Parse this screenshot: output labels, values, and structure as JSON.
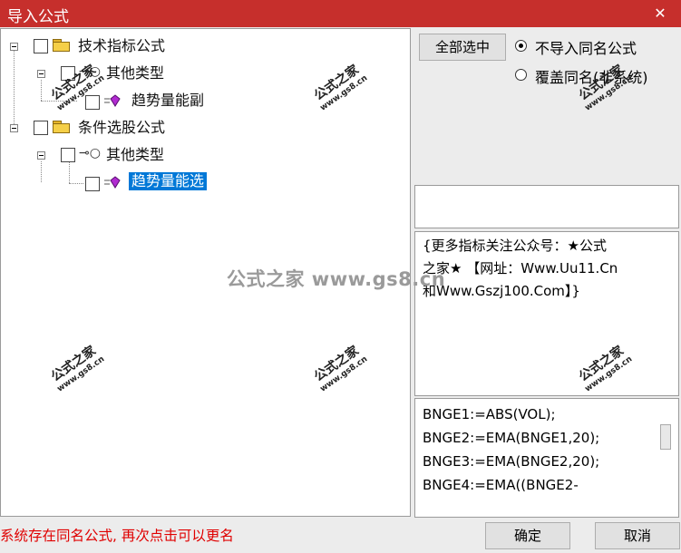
{
  "window": {
    "title": "导入公式",
    "close_glyph": "✕"
  },
  "tree": {
    "nodes": [
      {
        "label": "技术指标公式",
        "icon": "folder-icon"
      },
      {
        "label": "其他类型",
        "icon": "key-icon"
      },
      {
        "label": "趋势量能副",
        "icon": "formula-gem-icon"
      },
      {
        "label": "条件选股公式",
        "icon": "folder-icon"
      },
      {
        "label": "其他类型",
        "icon": "key-icon"
      },
      {
        "label": "趋势量能选",
        "icon": "formula-gem-icon",
        "selected": true
      }
    ]
  },
  "options": {
    "select_all_label": "全部选中",
    "radio1_label": "不导入同名公式",
    "radio2_label": "覆盖同名(非系统)",
    "selected_radio": 1
  },
  "description": {
    "line1": "{更多指标关注公众号：★公式",
    "line2": "之家★ 【网址：Www.Uu11.Cn",
    "line3": "和Www.Gszj100.Com】}"
  },
  "code": {
    "lines": [
      "BNGE1:=ABS(VOL);",
      "BNGE2:=EMA(BNGE1,20);",
      "BNGE3:=EMA(BNGE2,20);",
      "BNGE4:=EMA((BNGE2-"
    ]
  },
  "status": {
    "message": "系统存在同名公式, 再次点击可以更名"
  },
  "buttons": {
    "ok": "确定",
    "cancel": "取消"
  },
  "watermark": {
    "text": "公式之家",
    "url": "www.gs8.cn",
    "center": "公式之家 www.gs8.cn"
  }
}
